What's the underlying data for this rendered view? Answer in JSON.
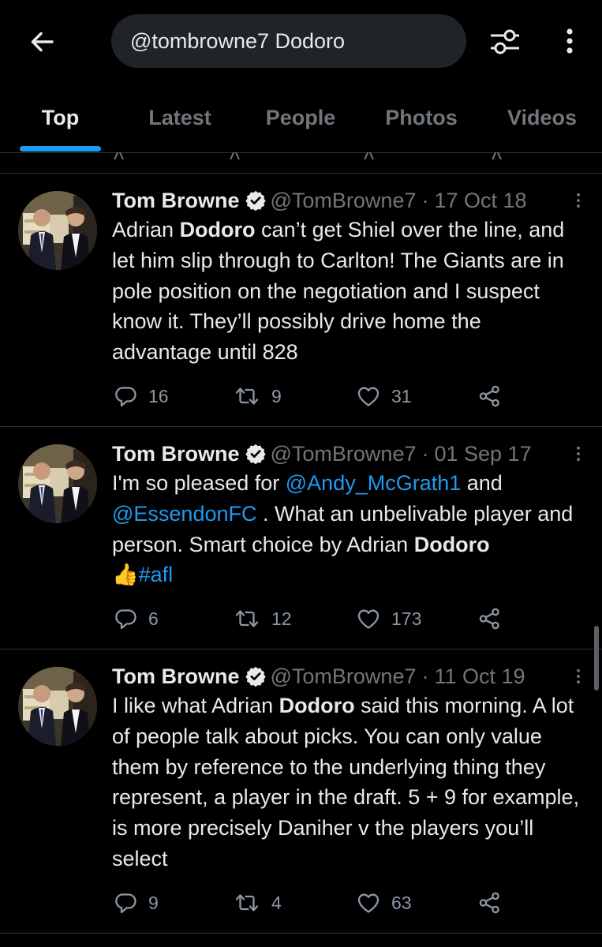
{
  "search": {
    "query": "@tombrowne7 Dodoro"
  },
  "tabs": [
    {
      "label": "Top",
      "active": true
    },
    {
      "label": "Latest"
    },
    {
      "label": "People"
    },
    {
      "label": "Photos"
    },
    {
      "label": "Videos"
    }
  ],
  "colors": {
    "accent": "#1d9bf0",
    "background": "#000000",
    "muted": "#71767b"
  },
  "icons": [
    "back-arrow-icon",
    "filter-icon",
    "more-vertical-icon",
    "verified-badge-icon",
    "reply-icon",
    "retweet-icon",
    "like-icon",
    "share-icon",
    "thumbs-up-emoji"
  ],
  "tweets": [
    {
      "name": "Tom Browne",
      "handle": "@TomBrowne7",
      "separator": "·",
      "date": "17 Oct 18",
      "text": {
        "p1": "Adrian ",
        "b1": "Dodoro",
        "p2": " can’t get Shiel over the line, and let him slip through to Carlton! The Giants are in pole position on the negotiation and I suspect know it. They’ll possibly drive home the advantage until 828"
      },
      "replies": "16",
      "retweets": "9",
      "likes": "31"
    },
    {
      "name": "Tom Browne",
      "handle": "@TomBrowne7",
      "separator": "·",
      "date": "01 Sep 17",
      "text": {
        "p1": "I'm so pleased for ",
        "m1": "@Andy_McGrath1",
        "p2": " and ",
        "m2": "@EssendonFC",
        "p3": " . What an unbelivable player and person. Smart choice by Adrian ",
        "b1": "Dodoro",
        "emoji": "👍",
        "hashtag": "#afl"
      },
      "replies": "6",
      "retweets": "12",
      "likes": "173"
    },
    {
      "name": "Tom Browne",
      "handle": "@TomBrowne7",
      "separator": "·",
      "date": "11 Oct 19",
      "text": {
        "p1": "I like what Adrian ",
        "b1": "Dodoro",
        "p2": " said this morning. A lot of people talk about picks. You can only value them by reference to the underlying thing they represent, a player in the draft. 5 + 9 for example, is more precisely Daniher v the players you’ll select"
      },
      "replies": "9",
      "retweets": "4",
      "likes": "63"
    }
  ]
}
